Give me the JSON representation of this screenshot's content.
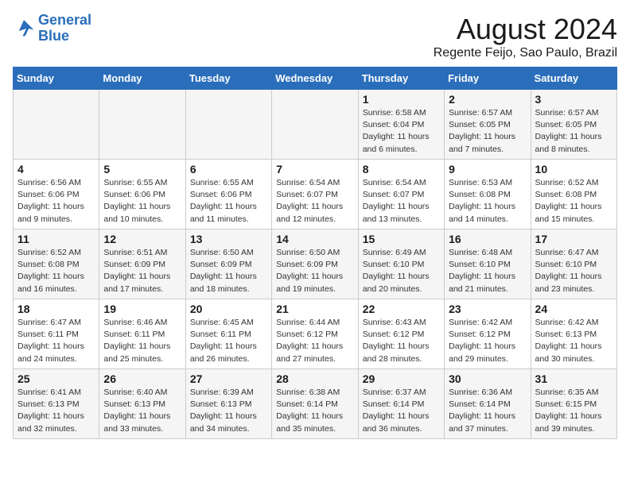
{
  "logo": {
    "line1": "General",
    "line2": "Blue"
  },
  "title": "August 2024",
  "location": "Regente Feijo, Sao Paulo, Brazil",
  "days_of_week": [
    "Sunday",
    "Monday",
    "Tuesday",
    "Wednesday",
    "Thursday",
    "Friday",
    "Saturday"
  ],
  "weeks": [
    [
      {
        "day": "",
        "info": ""
      },
      {
        "day": "",
        "info": ""
      },
      {
        "day": "",
        "info": ""
      },
      {
        "day": "",
        "info": ""
      },
      {
        "day": "1",
        "info": "Sunrise: 6:58 AM\nSunset: 6:04 PM\nDaylight: 11 hours\nand 6 minutes."
      },
      {
        "day": "2",
        "info": "Sunrise: 6:57 AM\nSunset: 6:05 PM\nDaylight: 11 hours\nand 7 minutes."
      },
      {
        "day": "3",
        "info": "Sunrise: 6:57 AM\nSunset: 6:05 PM\nDaylight: 11 hours\nand 8 minutes."
      }
    ],
    [
      {
        "day": "4",
        "info": "Sunrise: 6:56 AM\nSunset: 6:06 PM\nDaylight: 11 hours\nand 9 minutes."
      },
      {
        "day": "5",
        "info": "Sunrise: 6:55 AM\nSunset: 6:06 PM\nDaylight: 11 hours\nand 10 minutes."
      },
      {
        "day": "6",
        "info": "Sunrise: 6:55 AM\nSunset: 6:06 PM\nDaylight: 11 hours\nand 11 minutes."
      },
      {
        "day": "7",
        "info": "Sunrise: 6:54 AM\nSunset: 6:07 PM\nDaylight: 11 hours\nand 12 minutes."
      },
      {
        "day": "8",
        "info": "Sunrise: 6:54 AM\nSunset: 6:07 PM\nDaylight: 11 hours\nand 13 minutes."
      },
      {
        "day": "9",
        "info": "Sunrise: 6:53 AM\nSunset: 6:08 PM\nDaylight: 11 hours\nand 14 minutes."
      },
      {
        "day": "10",
        "info": "Sunrise: 6:52 AM\nSunset: 6:08 PM\nDaylight: 11 hours\nand 15 minutes."
      }
    ],
    [
      {
        "day": "11",
        "info": "Sunrise: 6:52 AM\nSunset: 6:08 PM\nDaylight: 11 hours\nand 16 minutes."
      },
      {
        "day": "12",
        "info": "Sunrise: 6:51 AM\nSunset: 6:09 PM\nDaylight: 11 hours\nand 17 minutes."
      },
      {
        "day": "13",
        "info": "Sunrise: 6:50 AM\nSunset: 6:09 PM\nDaylight: 11 hours\nand 18 minutes."
      },
      {
        "day": "14",
        "info": "Sunrise: 6:50 AM\nSunset: 6:09 PM\nDaylight: 11 hours\nand 19 minutes."
      },
      {
        "day": "15",
        "info": "Sunrise: 6:49 AM\nSunset: 6:10 PM\nDaylight: 11 hours\nand 20 minutes."
      },
      {
        "day": "16",
        "info": "Sunrise: 6:48 AM\nSunset: 6:10 PM\nDaylight: 11 hours\nand 21 minutes."
      },
      {
        "day": "17",
        "info": "Sunrise: 6:47 AM\nSunset: 6:10 PM\nDaylight: 11 hours\nand 23 minutes."
      }
    ],
    [
      {
        "day": "18",
        "info": "Sunrise: 6:47 AM\nSunset: 6:11 PM\nDaylight: 11 hours\nand 24 minutes."
      },
      {
        "day": "19",
        "info": "Sunrise: 6:46 AM\nSunset: 6:11 PM\nDaylight: 11 hours\nand 25 minutes."
      },
      {
        "day": "20",
        "info": "Sunrise: 6:45 AM\nSunset: 6:11 PM\nDaylight: 11 hours\nand 26 minutes."
      },
      {
        "day": "21",
        "info": "Sunrise: 6:44 AM\nSunset: 6:12 PM\nDaylight: 11 hours\nand 27 minutes."
      },
      {
        "day": "22",
        "info": "Sunrise: 6:43 AM\nSunset: 6:12 PM\nDaylight: 11 hours\nand 28 minutes."
      },
      {
        "day": "23",
        "info": "Sunrise: 6:42 AM\nSunset: 6:12 PM\nDaylight: 11 hours\nand 29 minutes."
      },
      {
        "day": "24",
        "info": "Sunrise: 6:42 AM\nSunset: 6:13 PM\nDaylight: 11 hours\nand 30 minutes."
      }
    ],
    [
      {
        "day": "25",
        "info": "Sunrise: 6:41 AM\nSunset: 6:13 PM\nDaylight: 11 hours\nand 32 minutes."
      },
      {
        "day": "26",
        "info": "Sunrise: 6:40 AM\nSunset: 6:13 PM\nDaylight: 11 hours\nand 33 minutes."
      },
      {
        "day": "27",
        "info": "Sunrise: 6:39 AM\nSunset: 6:13 PM\nDaylight: 11 hours\nand 34 minutes."
      },
      {
        "day": "28",
        "info": "Sunrise: 6:38 AM\nSunset: 6:14 PM\nDaylight: 11 hours\nand 35 minutes."
      },
      {
        "day": "29",
        "info": "Sunrise: 6:37 AM\nSunset: 6:14 PM\nDaylight: 11 hours\nand 36 minutes."
      },
      {
        "day": "30",
        "info": "Sunrise: 6:36 AM\nSunset: 6:14 PM\nDaylight: 11 hours\nand 37 minutes."
      },
      {
        "day": "31",
        "info": "Sunrise: 6:35 AM\nSunset: 6:15 PM\nDaylight: 11 hours\nand 39 minutes."
      }
    ]
  ]
}
